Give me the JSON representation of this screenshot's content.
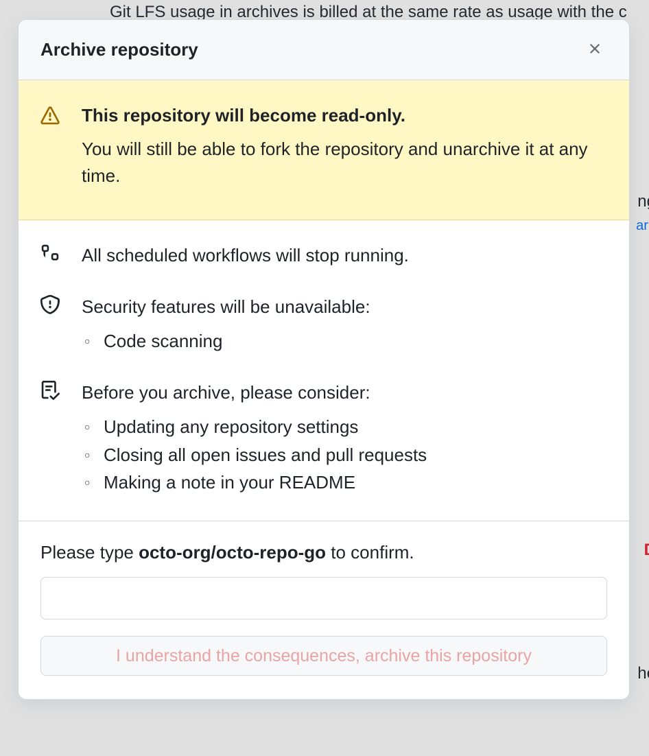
{
  "background": {
    "line1": "Git LFS usage in archives is billed at the same rate as usage with the c",
    "line2": "ng",
    "line3": "arn",
    "line4": "D",
    "line5": "he"
  },
  "dialog": {
    "title": "Archive repository",
    "warning": {
      "title": "This repository will become read-only.",
      "description": "You will still be able to fork the repository and unarchive it at any time."
    },
    "workflows": {
      "text": "All scheduled workflows will stop running."
    },
    "security": {
      "title": "Security features will be unavailable:",
      "items": [
        "Code scanning"
      ]
    },
    "considerations": {
      "title": "Before you archive, please consider:",
      "items": [
        "Updating any repository settings",
        "Closing all open issues and pull requests",
        "Making a note in your README"
      ]
    },
    "confirm": {
      "prefix": "Please type ",
      "repo": "octo-org/octo-repo-go",
      "suffix": " to confirm.",
      "button": "I understand the consequences, archive this repository",
      "input_value": ""
    }
  }
}
